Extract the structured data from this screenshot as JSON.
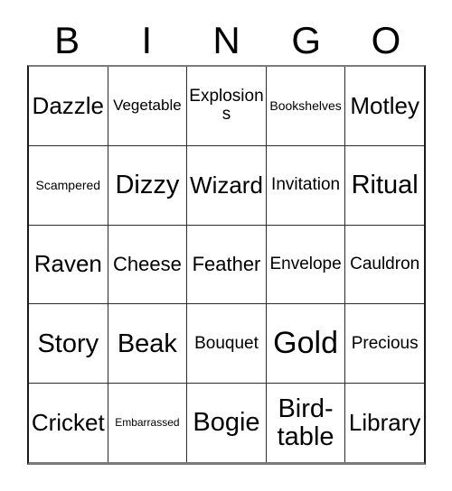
{
  "card": {
    "header_letters": [
      "B",
      "I",
      "N",
      "G",
      "O"
    ],
    "rows": [
      [
        {
          "text": "Dazzle",
          "size": "xl"
        },
        {
          "text": "Vegetable",
          "size": "m"
        },
        {
          "text": "Explosions",
          "size": "ml"
        },
        {
          "text": "Bookshelves",
          "size": "s"
        },
        {
          "text": "Motley",
          "size": "xl"
        }
      ],
      [
        {
          "text": "Scampered",
          "size": "s"
        },
        {
          "text": "Dizzy",
          "size": "xxl"
        },
        {
          "text": "Wizard",
          "size": "xl"
        },
        {
          "text": "Invitation",
          "size": "ml"
        },
        {
          "text": "Ritual",
          "size": "xxl"
        }
      ],
      [
        {
          "text": "Raven",
          "size": "xl"
        },
        {
          "text": "Cheese",
          "size": "l"
        },
        {
          "text": "Feather",
          "size": "l"
        },
        {
          "text": "Envelope",
          "size": "ml"
        },
        {
          "text": "Cauldron",
          "size": "ml"
        }
      ],
      [
        {
          "text": "Story",
          "size": "xxl"
        },
        {
          "text": "Beak",
          "size": "xxl"
        },
        {
          "text": "Bouquet",
          "size": "ml"
        },
        {
          "text": "Gold",
          "size": "huge"
        },
        {
          "text": "Precious",
          "size": "ml"
        }
      ],
      [
        {
          "text": "Cricket",
          "size": "xl"
        },
        {
          "text": "Embarrassed",
          "size": "xs"
        },
        {
          "text": "Bogie",
          "size": "xxl"
        },
        {
          "text": "Bird-table",
          "size": "xxl"
        },
        {
          "text": "Library",
          "size": "xl"
        }
      ]
    ]
  },
  "colors": {
    "background": "#ffffff",
    "text": "#000000",
    "grid_line": "#2b2b2b",
    "outer_border": "#7a7a7a"
  }
}
